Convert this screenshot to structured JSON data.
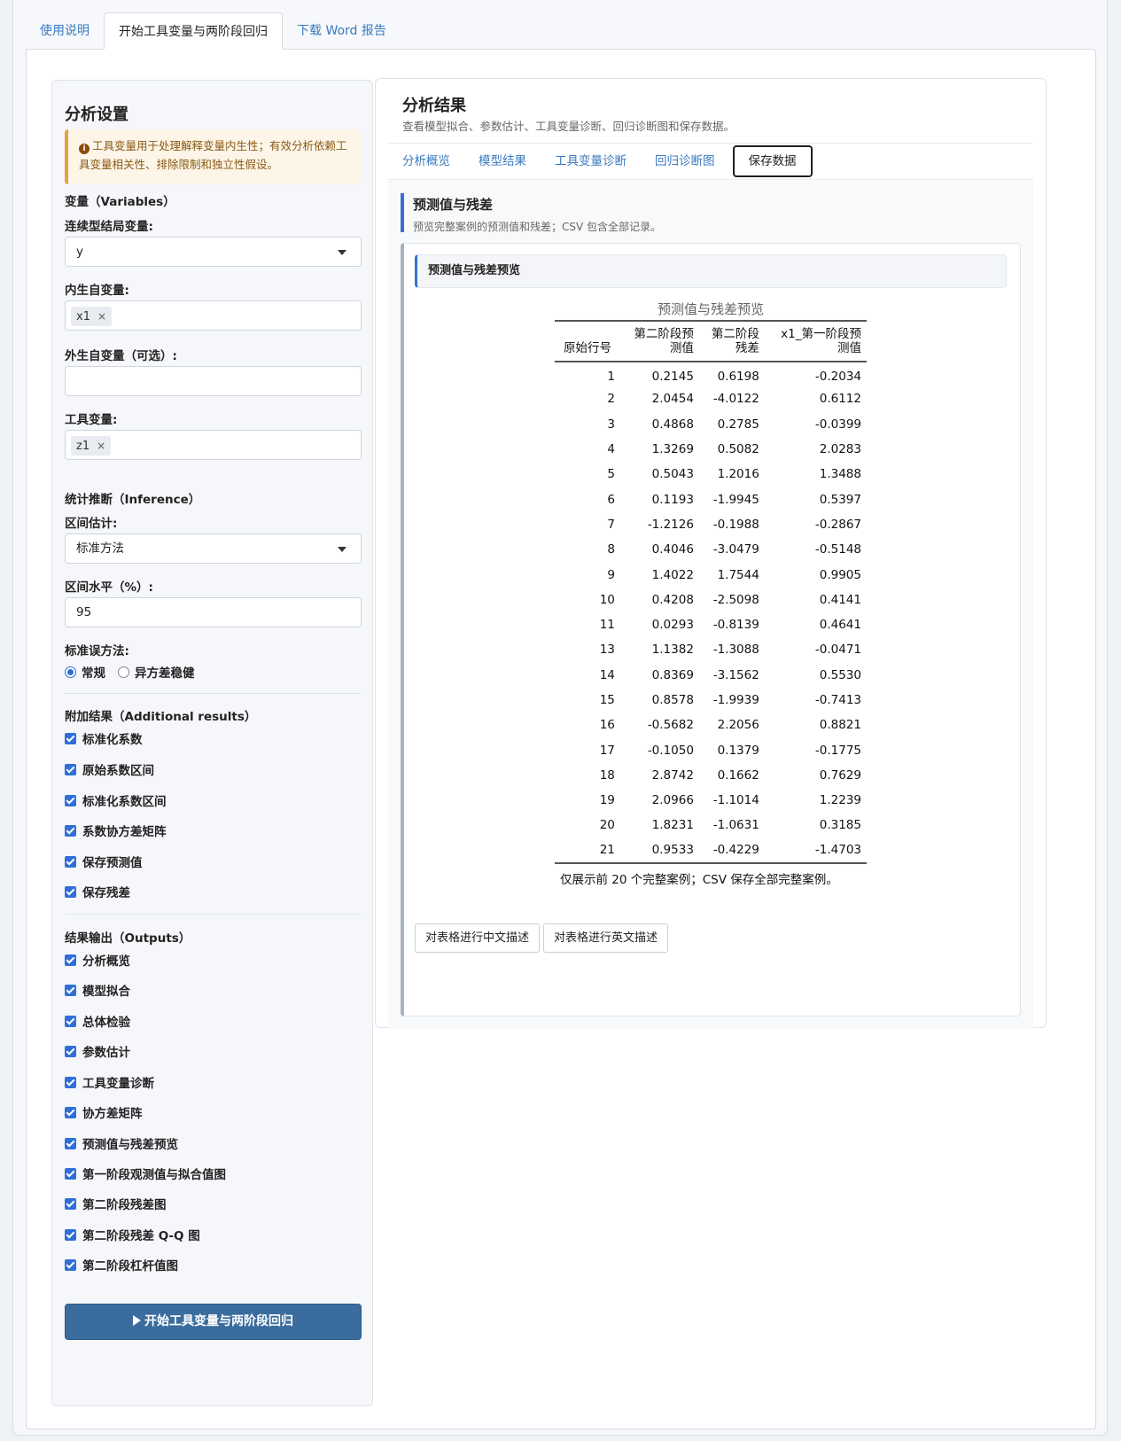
{
  "top_tabs": [
    "使用说明",
    "开始工具变量与两阶段回归",
    "下载 Word 报告"
  ],
  "sidebar": {
    "title": "分析设置",
    "notice": "工具变量用于处理解释变量内生性；有效分析依赖工具变量相关性、排除限制和独立性假设。",
    "variables_section": "变量（Variables）",
    "outcome_label": "连续型结局变量:",
    "outcome_value": "y",
    "endog_label": "内生自变量:",
    "endog_chip": "x1",
    "exog_label": "外生自变量（可选）:",
    "instr_label": "工具变量:",
    "instr_chip": "z1",
    "chip_remove": "×",
    "inference_section": "统计推断（Inference）",
    "interval_label": "区间估计:",
    "interval_value": "标准方法",
    "level_label": "区间水平（%）:",
    "level_value": "95",
    "se_label": "标准误方法:",
    "se_options": [
      "常规",
      "异方差稳健"
    ],
    "additional_section": "附加结果（Additional results）",
    "additional_items": [
      "标准化系数",
      "原始系数区间",
      "标准化系数区间",
      "系数协方差矩阵",
      "保存预测值",
      "保存残差"
    ],
    "outputs_section": "结果输出（Outputs）",
    "output_items": [
      "分析概览",
      "模型拟合",
      "总体检验",
      "参数估计",
      "工具变量诊断",
      "协方差矩阵",
      "预测值与残差预览",
      "第一阶段观测值与拟合值图",
      "第二阶段残差图",
      "第二阶段残差 Q-Q 图",
      "第二阶段杠杆值图"
    ],
    "run_button": "开始工具变量与两阶段回归"
  },
  "results": {
    "title": "分析结果",
    "subtitle": "查看模型拟合、参数估计、工具变量诊断、回归诊断图和保存数据。",
    "tabs": [
      "分析概览",
      "模型结果",
      "工具变量诊断",
      "回归诊断图",
      "保存数据"
    ],
    "section_title": "预测值与残差",
    "section_subtitle": "预览完整案例的预测值和残差；CSV 包含全部记录。",
    "card_title": "预测值与残差预览",
    "table_caption": "预测值与残差预览",
    "columns": [
      "原始行号",
      "第二阶段预\n测值",
      "第二阶段\n残差",
      "x1_第一阶段预\n测值"
    ],
    "rows": [
      [
        "1",
        "0.2145",
        "0.6198",
        "-0.2034"
      ],
      [
        "2",
        "2.0454",
        "-4.0122",
        "0.6112"
      ],
      [
        "3",
        "0.4868",
        "0.2785",
        "-0.0399"
      ],
      [
        "4",
        "1.3269",
        "0.5082",
        "2.0283"
      ],
      [
        "5",
        "0.5043",
        "1.2016",
        "1.3488"
      ],
      [
        "6",
        "0.1193",
        "-1.9945",
        "0.5397"
      ],
      [
        "7",
        "-1.2126",
        "-0.1988",
        "-0.2867"
      ],
      [
        "8",
        "0.4046",
        "-3.0479",
        "-0.5148"
      ],
      [
        "9",
        "1.4022",
        "1.7544",
        "0.9905"
      ],
      [
        "10",
        "0.4208",
        "-2.5098",
        "0.4141"
      ],
      [
        "11",
        "0.0293",
        "-0.8139",
        "0.4641"
      ],
      [
        "13",
        "1.1382",
        "-1.3088",
        "-0.0471"
      ],
      [
        "14",
        "0.8369",
        "-3.1562",
        "0.5530"
      ],
      [
        "15",
        "0.8578",
        "-1.9939",
        "-0.7413"
      ],
      [
        "16",
        "-0.5682",
        "2.2056",
        "0.8821"
      ],
      [
        "17",
        "-0.1050",
        "0.1379",
        "-0.1775"
      ],
      [
        "18",
        "2.8742",
        "0.1662",
        "0.7629"
      ],
      [
        "19",
        "2.0966",
        "-1.1014",
        "1.2239"
      ],
      [
        "20",
        "1.8231",
        "-1.0631",
        "0.3185"
      ],
      [
        "21",
        "0.9533",
        "-0.4229",
        "-1.4703"
      ]
    ],
    "table_note": "仅展示前 20 个完整案例；CSV 保存全部完整案例。",
    "desc_buttons": [
      "对表格进行中文描述",
      "对表格进行英文描述"
    ]
  },
  "colors": {
    "accent": "#3a6fd1",
    "primary_button": "#3a6d9e",
    "notice_border": "#e6a23c"
  }
}
